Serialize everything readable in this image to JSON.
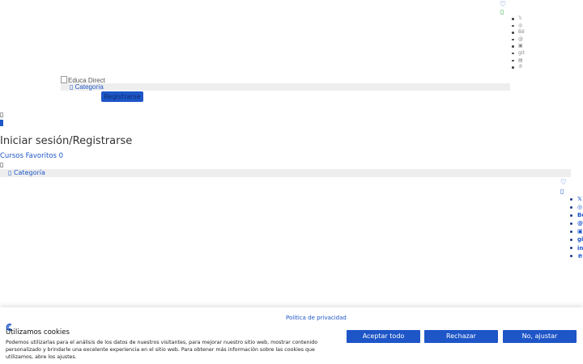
{
  "header": {
    "heart_icon_glyph": "♡",
    "box_glyph": "▯",
    "social_small": [
      {
        "name": "x-icon",
        "glyph": "𝕏"
      },
      {
        "name": "instagram-icon",
        "glyph": "◎"
      },
      {
        "name": "behance-icon",
        "glyph": "Bē"
      },
      {
        "name": "threads-icon",
        "glyph": "@"
      },
      {
        "name": "square-icon",
        "glyph": "▣"
      },
      {
        "name": "git-icon",
        "glyph": "git"
      },
      {
        "name": "linkedin-icon",
        "glyph": "▤"
      },
      {
        "name": "pinterest-icon",
        "glyph": "℗"
      }
    ],
    "logo_alt": "Educa Direct",
    "category_label": "Categoría",
    "category_glyph": "▯",
    "register_button": "Registrarse"
  },
  "mobile": {
    "box_glyph": "▯",
    "login_title": "Iniciar sesión/Registrarse",
    "favorites_label": "Cursos Favoritos",
    "favorites_count": "0",
    "category_label": "Categoría",
    "category_glyph": "▯",
    "heart_icon_glyph": "♡",
    "social_large": [
      {
        "name": "x-icon",
        "glyph": "𝕏"
      },
      {
        "name": "instagram-icon",
        "glyph": "◎"
      },
      {
        "name": "behance-icon",
        "glyph": "Bē"
      },
      {
        "name": "threads-icon",
        "glyph": "@"
      },
      {
        "name": "square-icon",
        "glyph": "▣"
      },
      {
        "name": "git-icon",
        "glyph": "git"
      },
      {
        "name": "linkedin-icon",
        "glyph": "in"
      },
      {
        "name": "pinterest-icon",
        "glyph": "℗"
      }
    ]
  },
  "cookie_banner": {
    "privacy_link": "Política de privacidad",
    "title": "Utilizamos cookies",
    "text": "Podemos utilizarlas para el análisis de los datos de nuestros visitantes, para mejorar nuestro sitio web, mostrar contenido personalizado y brindarle una excelente experiencia en el sitio web. Para obtener más información sobre las cookies que utilizamos, abre los ajustes.",
    "accept_all": "Aceptar todo",
    "reject": "Rechazar",
    "adjust": "No, ajustar",
    "accent_color": "#1e56c8"
  }
}
